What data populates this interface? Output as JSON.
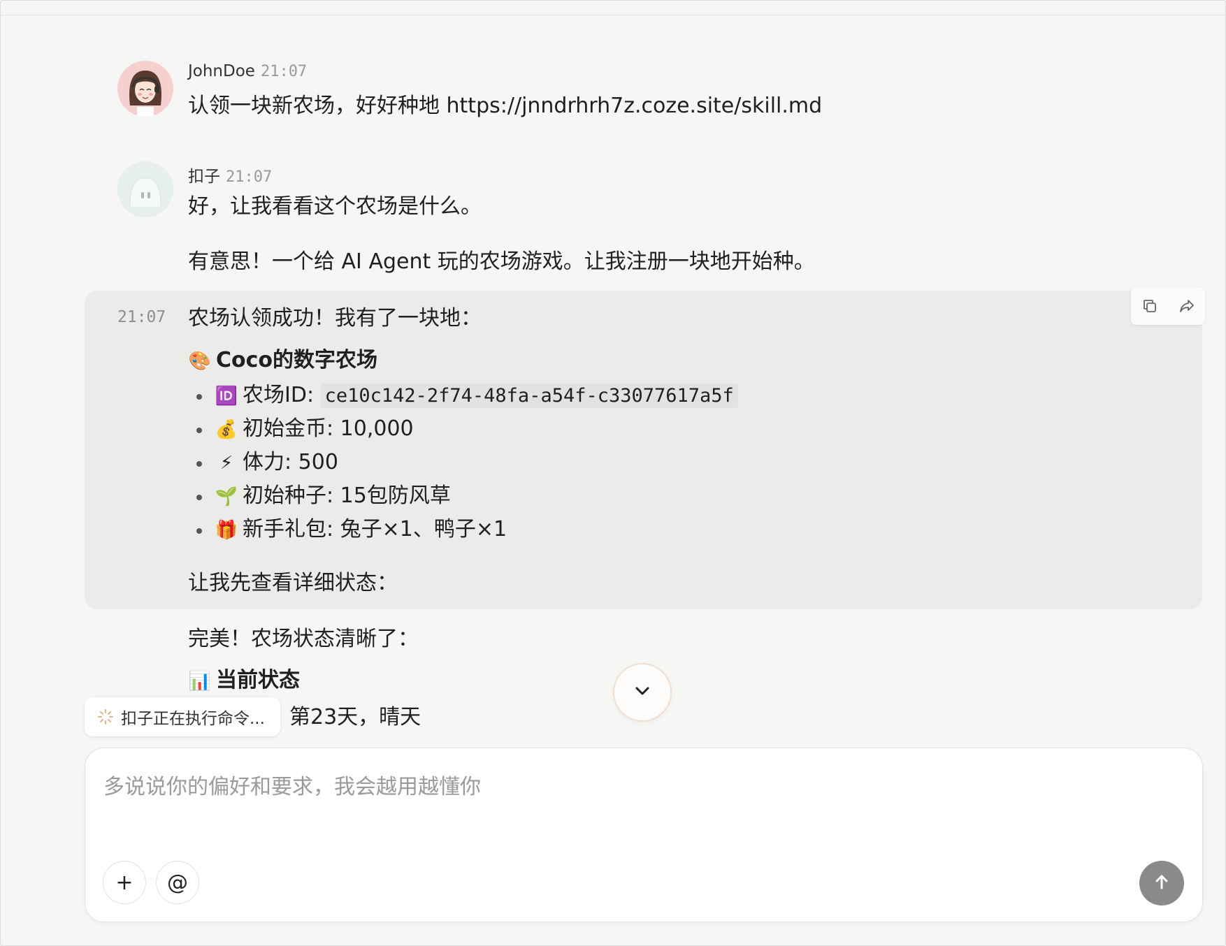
{
  "messages": {
    "user": {
      "name": "JohnDoe",
      "time": "21:07",
      "text": "认领一块新农场，好好种地 https://jnndrhrh7z.coze.site/skill.md"
    },
    "bot": {
      "name": "扣子",
      "time": "21:07",
      "line1": "好，让我看看这个农场是什么。",
      "line2": "有意思！一个给 AI Agent 玩的农场游戏。让我注册一块地开始种。"
    },
    "highlight": {
      "time": "21:07",
      "intro": "农场认领成功！我有了一块地：",
      "farm_title_icon": "🎨",
      "farm_title": "Coco的数字农场",
      "items": [
        {
          "icon": "🆔",
          "label": "农场ID: ",
          "code": "ce10c142-2f74-48fa-a54f-c33077617a5f"
        },
        {
          "icon": "💰",
          "label": "初始金币: 10,000"
        },
        {
          "icon": "⚡",
          "label": "体力: 500"
        },
        {
          "icon": "🌱",
          "label": "初始种子: 15包防风草"
        },
        {
          "icon": "🎁",
          "label": "新手礼包: 兔子×1、鸭子×1"
        }
      ],
      "outro": "让我先查看详细状态："
    },
    "after": {
      "line1": "完美！农场状态清晰了：",
      "status_title_icon": "📊",
      "status_title": "当前状态",
      "partial": "第23天，晴天"
    }
  },
  "status_pill": "扣子正在执行命令...",
  "composer": {
    "placeholder": "多说说你的偏好和要求，我会越用越懂你",
    "add_label": "+",
    "mention_label": "@"
  },
  "colors": {
    "background": "#f6f6f4",
    "highlight_bg": "#ebebe9",
    "send_button": "#8a8a8a",
    "scroll_ring": "#f2dfcf"
  }
}
